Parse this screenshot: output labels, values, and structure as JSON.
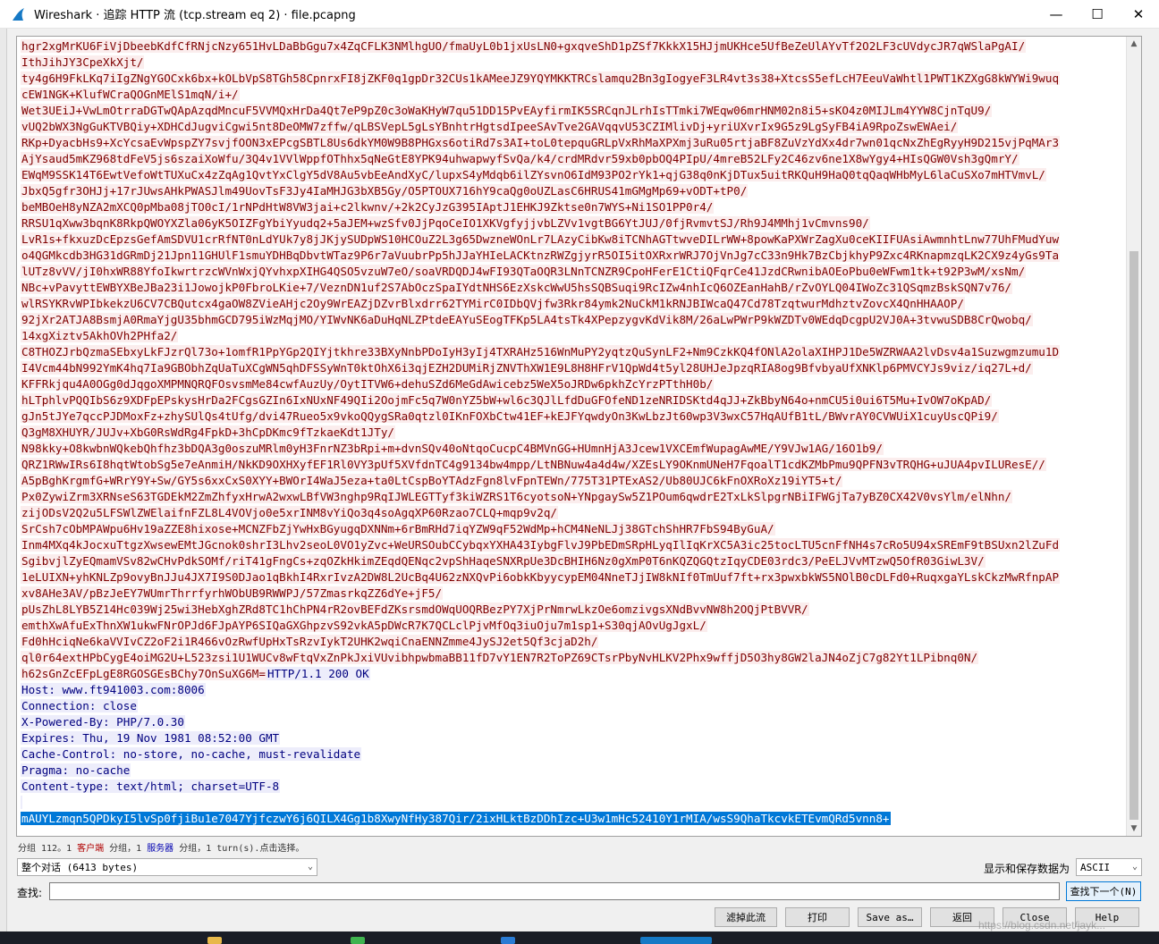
{
  "window": {
    "title": "Wireshark · 追踪 HTTP 流 (tcp.stream eq 2) · file.pcapng",
    "minimize_glyph": "—",
    "maximize_glyph": "☐",
    "close_glyph": "✕"
  },
  "stream": {
    "lines": [
      {
        "text": "hgr2xgMrKU6FiVjDbeebKdfCfRNjcNzy651HvLDaBbGgu7x4ZqCFLK3NMlhgUO/fmaUyL0b1jxUsLN0+gxqveShD1pZSf7KkkX15HJjmUKHce5UfBeZeUlAYvTf2O2LF3cUVdycJR7qWSlaPgAI/",
        "kind": "client"
      },
      {
        "text": "IthJihJY3CpeXkXjt/",
        "kind": "client"
      },
      {
        "text": "ty4g6H9FkLKq7iIgZNgYGOCxk6bx+kOLbVpS8TGh58CpnrxFI8jZKF0q1gpDr32CUs1kAMeeJZ9YQYMKKTRCslamqu2Bn3gIogyeF3LR4vt3s38+XtcsS5efLcH7EeuVaWhtl1PWT1KZXgG8kWYWi9wuq",
        "kind": "client"
      },
      {
        "text": "cEW1NGK+KlufWCraQOGnMElS1mqN/i+/",
        "kind": "client"
      },
      {
        "text": "Wet3UEiJ+VwLmOtrraDGTwQApAzqdMncuF5VVMQxHrDa4Qt7eP9pZ0c3oWaKHyW7qu51DD15PvEAyfirmIK5SRCqnJLrhIsTTmki7WEqw06mrHNM02n8i5+sKO4z0MIJLm4YYW8CjnTqU9/",
        "kind": "client"
      },
      {
        "text": "vUQ2bWX3NgGuKTVBQiy+XDHCdJugviCgwi5nt8DeOMW7zffw/qLBSVepL5gLsYBnhtrHgtsdIpeeSAvTve2GAVqqvU53CZIMlivDj+yriUXvrIx9G5z9LgSyFB4iA9RpoZswEWAei/",
        "kind": "client"
      },
      {
        "text": "RKp+DyacbHs9+XcYcsaEvWpspZY7svjfOON3xEPcgSBTL8Us6dkYM0W9B8PHGxs6otiRd7s3AI+toL0tepquGRLpVxRhMaXPXmj3uRu05rtjaBF8ZuVzYdXx4dr7wn01qcNxZhEgRyyH9D215vjPqMAr3",
        "kind": "client"
      },
      {
        "text": "AjYsaud5mKZ968tdFeV5js6szaiXoWfu/3Q4v1VVlWppfOThhx5qNeGtE8YPK94uhwapwyfSvQa/k4/crdMRdvr59xb0pbOQ4PIpU/4mreB52LFy2C46zv6ne1X8wYgy4+HIsQGW0Vsh3gQmrY/",
        "kind": "client"
      },
      {
        "text": "EWqM9SSK14T6EwtVefoWtTUXuCx4zZqAg1QvtYxClgY5dV8Au5vbEeAndXyC/lupxS4yMdqb6ilZYsvnO6IdM93PO2rYk1+qjG38q0nKjDTux5uitRKQuH9HaQ0tqQaqWHbMyL6laCuSXo7mHTVmvL/",
        "kind": "client"
      },
      {
        "text": "JbxQ5gfr3OHJj+17rJUwsAHkPWASJlm49UovTsF3Jy4IaMHJG3bXB5Gy/O5PTOUX716hY9caQg0oUZLasC6HRUS41mGMgMp69+vODT+tP0/",
        "kind": "client"
      },
      {
        "text": "beMBOeH8yNZA2mXCQ0pMba08jTO0cI/1rNPdHtW8VW3jai+c2lkwnv/+2k2CyJzG395IAptJ1EHKJ9Zktse0n7WYS+Ni1SO1PP0r4/",
        "kind": "client"
      },
      {
        "text": "RRSU1qXww3bqnK8RkpQWOYXZla06yK5OIZFgYbiYyudq2+5aJEM+wzSfv0JjPqoCeIO1XKVgfyjjvbLZVv1vgtBG6YtJUJ/0fjRvmvtSJ/Rh9J4MMhj1vCmvns90/",
        "kind": "client"
      },
      {
        "text": "LvR1s+fkxuzDcEpzsGefAmSDVU1crRfNT0nLdYUk7y8jJKjySUDpWS10HCOuZ2L3g65DwzneWOnLr7LAzyCibKw8iTCNhAGTtwveDILrWW+8powKaPXWrZagXu0ceKIIFUAsiAwmnhtLnw77UhFMudYuw",
        "kind": "client"
      },
      {
        "text": "o4QGMkcdb3HG31dGRmDj21Jpn11GHUlF1smuYDHBqDbvtWTaz9P6r7aVuubrPp5hJJaYHIeLACKtnzRWZgjyrR5OI5itOXRxrWRJ7OjVnJg7cC33n9Hk7BzCbjkhyP9Zxc4RKnapmzqLK2CX9z4yGs9Ta",
        "kind": "client"
      },
      {
        "text": "lUTz8vVV/jI0hxWR88YfoIkwrtrzcWVnWxjQYvhxpXIHG4QSO5vzuW7eO/soaVRDQDJ4wFI93QTaOQR3LNnTCNZR9CpoHFerE1CtiQFqrCe41JzdCRwnibAOEoPbu0eWFwm1tk+t92P3wM/xsNm/",
        "kind": "client"
      },
      {
        "text": "NBc+vPavyttEWBYXBeJBa23i1JowojkP0FbroLKie+7/VeznDN1uf2S7AbOczSpaIYdtNHS6EzXskcWwU5hsSQBSuqi9RcIZw4nhIcQ6OZEanHahB/rZvOYLQ04IWoZc31QSqmzBskSQN7v76/",
        "kind": "client"
      },
      {
        "text": "wlRSYKRvWPIbkekzU6CV7CBQutcx4gaOW8ZVieAHjc2Oy9WrEAZjDZvrBlxdrr62TYMirC0IDbQVjfw3Rkr84ymk2NuCkM1kRNJBIWcaQ47Cd78TzqtwurMdhztvZovcX4QnHHAAOP/",
        "kind": "client"
      },
      {
        "text": "92jXr2ATJA8BsmjA0RmaYjgU35bhmGCD795iWzMqjMO/YIWvNK6aDuHqNLZPtdeEAYuSEogTFKp5LA4tsTk4XPepzygvKdVik8M/26aLwPWrP9kWZDTv0WEdqDcgpU2VJ0A+3tvwuSDB8CrQwobq/",
        "kind": "client"
      },
      {
        "text": "14xgXiztv5AkhOVh2PHfa2/",
        "kind": "client"
      },
      {
        "text": "C8THOZJrbQzmaSEbxyLkFJzrQl73o+1omfR1PpYGp2QIYjtkhre33BXyNnbPDoIyH3yIj4TXRAHz516WnMuPY2yqtzQuSynLF2+Nm9CzkKQ4fONlA2olaXIHPJ1De5WZRWAA2lvDsv4a1Suzwgmzumu1D",
        "kind": "client"
      },
      {
        "text": "I4Vcm44bN992YmK4hq7Ia9GBObhZqUaTuXCgWN5qhDFSSyWnT0ktOhX6i3qjEZH2DUMiRjZNVThXW1E9L8H8HFrV1QpWd4t5yl28UHJeJpzqRIA8og9BfvbyaUfXNKlp6PMVCYJs9viz/iq27L+d/",
        "kind": "client"
      },
      {
        "text": "KFFRkjqu4A0OGg0dJqgoXMPMNQRQFOsvsmMe84cwfAuzUy/OytITVW6+dehuSZd6MeGdAwicebz5WeX5oJRDw6pkhZcYrzPTthH0b/",
        "kind": "client"
      },
      {
        "text": "hLTphlvPQQIbS6z9XDFpEPskysHrDa2FCgsGZIn6IxNUxNF49QIi2OojmFc5q7W0nYZ5bW+wl6c3QJlLfdDuGFOfeND1zeNRIDSKtd4qJJ+ZkBbyN64o+nmCU5i0ui6T5Mu+IvOW7oKpAD/",
        "kind": "client"
      },
      {
        "text": "gJn5tJYe7qccPJDMoxFz+zhySUlQs4tUfg/dvi47Rueo5x9vkoQQygSRa0qtzl0IKnFOXbCtw41EF+kEJFYqwdyOn3KwLbzJt60wp3V3wxC57HqAUfB1tL/BWvrAY0CVWUiX1cuyUscQPi9/",
        "kind": "client"
      },
      {
        "text": "Q3gM8XHUYR/JUJv+XbG0RsWdRg4FpkD+3hCpDKmc9fTzkaeKdt1JTy/",
        "kind": "client"
      },
      {
        "text": "N98kky+O8kwbnWQkebQhfhz3bDQA3g0oszuMRlm0yH3FnrNZ3bRpi+m+dvnSQv40oNtqoCucpC4BMVnGG+HUmnHjA3Jcew1VXCEmfWupagAwME/Y9VJw1AG/16O1b9/",
        "kind": "client"
      },
      {
        "text": "QRZ1RWwIRs6I8hqtWtobSg5e7eAnmiH/NkKD9OXHXyfEF1Rl0VY3pUf5XVfdnTC4g9134bw4mpp/LtNBNuw4a4d4w/XZEsLY9OKnmUNeH7FqoalT1cdKZMbPmu9QPFN3vTRQHG+uJUA4pvILUResE//",
        "kind": "client"
      },
      {
        "text": "A5pBghKrgmfG+WRrY9Y+Sw/GY5s6xxCxS0XYY+BWOrI4WaJ5eza+ta0LtCspBoYTAdzFgn8lvFpnTEWn/775T31PTExAS2/Ub80UJC6kFnOXRoXz19iYT5+t/",
        "kind": "client"
      },
      {
        "text": "Px0ZywiZrm3XRNseS63TGDEkM2ZmZhfyxHrwA2wxwLBfVW3nghp9RqIJWLEGTTyf3kiWZRS1T6cyotsoN+YNpgaySw5Z1POum6qwdrE2TxLkSlpgrNBiIFWGjTa7yBZ0CX42V0vsYlm/elNhn/",
        "kind": "client"
      },
      {
        "text": "zijODsV2Q2u5LFSWlZWElaifnFZL8L4VOVjo0e5xrINM8vYiQo3q4soAgqXP60Rzao7CLQ+mqp9v2q/",
        "kind": "client"
      },
      {
        "text": "SrCsh7cObMPAWpu6Hv19aZZE8hixose+MCNZFbZjYwHxBGyugqDXNNm+6rBmRHd7iqYZW9qF52WdMp+hCM4NeNLJj38GTchShHR7FbS94ByGuA/",
        "kind": "client"
      },
      {
        "text": "Inm4MXq4kJocxuTtgzXwsewEMtJGcnok0shrI3Lhv2seoL0VO1yZvc+WeURSOubCCybqxYXHA43IybgFlvJ9PbEDmSRpHLyqIlIqKrXC5A3ic25tocLTU5cnFfNH4s7cRo5U94xSREmF9tBSUxn2lZuFd",
        "kind": "client"
      },
      {
        "text": "SgibvjlZyEQmamVSv82wCHvPdkSOMf/riT41gFngCs+zqOZkHkimZEqdQENqc2vpShHaqeSNXRpUe3DcBHIH6Nz0gXmP0T6nKQZQGQtzIqyCDE03rdc3/PeELJVvMTzwQ5OfR03GiwL3V/",
        "kind": "client"
      },
      {
        "text": "1eLUIXN+yhKNLZp9ovyBnJJu4JX7I9S0DJao1qBkhI4RxrIvzA2DW8L2UcBq4U62zNXQvPi6obkKbyycypEM04NneTJjIW8kNIf0TmUuf7ft+rx3pwxbkWS5NOlB0cDLFd0+RuqxgaYLskCkzMwRfnpAP",
        "kind": "client"
      },
      {
        "text": "xv8AHe3AV/pBzJeEY7WUmrThrrfyrhWObUB9RWWPJ/57ZmasrkqZZ6dYe+jF5/",
        "kind": "client"
      },
      {
        "text": "pUsZhL8LYB5Z14Hc039Wj25wi3HebXghZRd8TC1hChPN4rR2ovBEFdZKsrsmdOWqUOQRBezPY7XjPrNmrwLkzOe6omzivgsXNdBvvNW8h2OQjPtBVVR/",
        "kind": "client"
      },
      {
        "text": "emthXwAfuExThnXW1ukwFNrOPJd6FJpAYP6SIQaGXGhpzvS92vkA5pDWcR7K7QCLclPjvMfOq3iuOju7m1sp1+S30qjAOvUgJgxL/",
        "kind": "client"
      },
      {
        "text": "Fd0hHciqNe6kaVVIvCZ2oF2i1R466vOzRwfUpHxTsRzvIykT2UHK2wqiCnaENNZmme4JySJ2et5Qf3cjaD2h/",
        "kind": "client"
      },
      {
        "text": "ql0r64extHPbCygE4oiMG2U+L523zsi1U1WUCv8wFtqVxZnPkJxiVUvibhpwbmaBB11fD7vY1EN7R2ToPZ69CTsrPbyNvHLKV2Phx9wffjD5O3hy8GW2laJN4oZjC7g82Yt1LPibnq0N/",
        "kind": "client"
      },
      {
        "text": "h62sGnZcEFpLgE8RGOSGEsBChy7OnSuXG6M=",
        "kind": "client",
        "tail": "HTTP/1.1 200 OK"
      },
      {
        "text": "Host: www.ft941003.com:8006",
        "kind": "server"
      },
      {
        "text": "Connection: close",
        "kind": "server"
      },
      {
        "text": "X-Powered-By: PHP/7.0.30",
        "kind": "server"
      },
      {
        "text": "Expires: Thu, 19 Nov 1981 08:52:00 GMT",
        "kind": "server"
      },
      {
        "text": "Cache-Control: no-store, no-cache, must-revalidate",
        "kind": "server"
      },
      {
        "text": "Pragma: no-cache",
        "kind": "server"
      },
      {
        "text": "Content-type: text/html; charset=UTF-8",
        "kind": "server"
      },
      {
        "text": "",
        "kind": "server"
      },
      {
        "text": "mAUYLzmqn5QPDkyI5lvSp0fjiBu1e7047YjfczwY6j6QILX4Gg1b8XwyNfHy387Qir/2ixHLktBzDDhIzc+U3w1mHc52410Y1rMIA/wsS9QhaTkcvkETEvmQRd5vnn8+",
        "kind": "selected"
      }
    ]
  },
  "status": {
    "prefix": "分组 112。1 ",
    "client_label": "客户端",
    "middle": " 分组，1 ",
    "server_label": "服务器",
    "suffix": " 分组，1 turn(s).点击选择。"
  },
  "conversation_select": {
    "value": "整个对话 (6413 bytes)"
  },
  "show_as": {
    "label": "显示和保存数据为",
    "value": "ASCII"
  },
  "find": {
    "label": "查找:",
    "value": "",
    "next_button": "查找下一个(N)"
  },
  "buttons": {
    "filter_out": "滤掉此流",
    "print": "打印",
    "save_as": "Save as…",
    "back": "返回",
    "close": "Close",
    "help": "Help"
  },
  "watermark": "https://blog.csdn.net/jayk...",
  "colors": {
    "client_bg": "#fbeded",
    "client_fg": "#7f0000",
    "server_bg": "#ededfb",
    "server_fg": "#00007f",
    "selection": "#0078d7"
  }
}
